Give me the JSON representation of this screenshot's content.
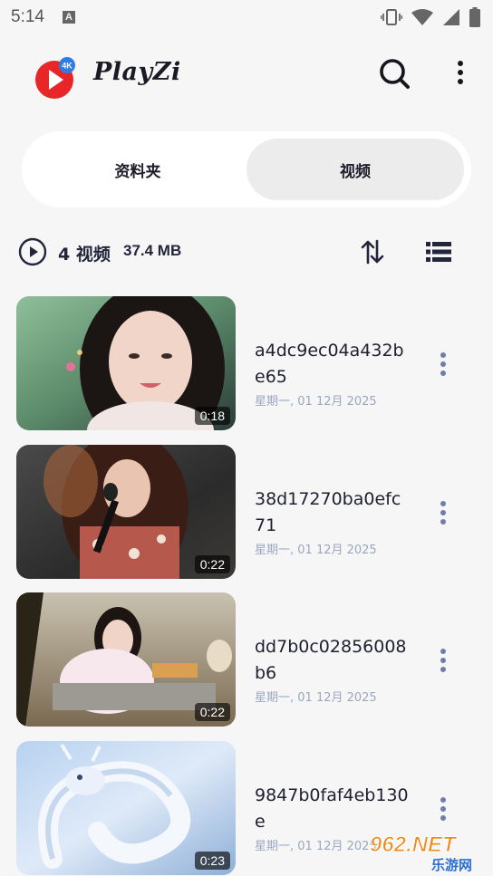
{
  "status_bar": {
    "time": "5:14",
    "notification_letter": "A"
  },
  "app": {
    "title": "PlayZi",
    "logo_badge": "4K"
  },
  "tabs": [
    {
      "label": "资料夹",
      "active": false
    },
    {
      "label": "视频",
      "active": true
    }
  ],
  "summary": {
    "count_label": "4 视频",
    "size_label": "37.4 MB"
  },
  "videos": [
    {
      "name": "a4dc9ec04a432be65",
      "date": "星期一, 01 12月 2025",
      "duration": "0:18"
    },
    {
      "name": "38d17270ba0efc71",
      "date": "星期一, 01 12月 2025",
      "duration": "0:22"
    },
    {
      "name": "dd7b0c02856008b6",
      "date": "星期一, 01 12月 2025",
      "duration": "0:22"
    },
    {
      "name": "9847b0faf4eb130e",
      "date": "星期一, 01 12月 2025",
      "duration": "0:23"
    }
  ],
  "watermark": {
    "text": "962.NET",
    "subtext": "乐游网"
  },
  "colors": {
    "accent_red": "#e8262a",
    "text_dark": "#1e2030",
    "date_text": "#9aa7bf",
    "tab_active_bg": "#ececec"
  },
  "icons": {
    "search": "search-icon",
    "menu": "more-vertical-icon",
    "play": "play-circle-icon",
    "sort": "sort-arrows-icon",
    "list": "list-view-icon"
  }
}
